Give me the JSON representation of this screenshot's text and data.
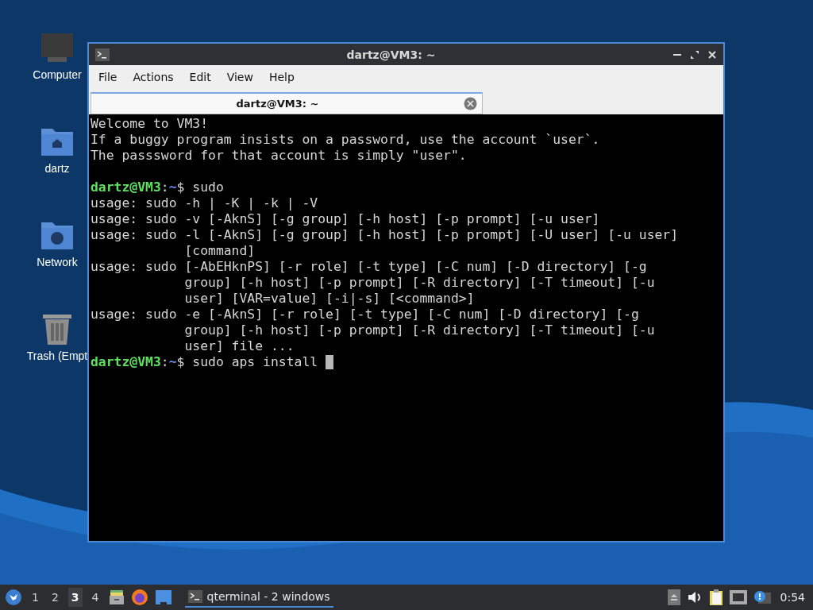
{
  "desktop_icons": [
    {
      "label": "Computer",
      "kind": "computer"
    },
    {
      "label": "dartz",
      "kind": "home"
    },
    {
      "label": "Network",
      "kind": "network"
    },
    {
      "label": "Trash (Empt",
      "kind": "trash"
    }
  ],
  "window": {
    "title": "dartz@VM3: ~",
    "menu": [
      "File",
      "Actions",
      "Edit",
      "View",
      "Help"
    ],
    "tabs": [
      {
        "label": "dartz@VM3: ~",
        "selected": true
      }
    ],
    "lines": [
      {
        "kind": "output",
        "text": "Welcome to VM3!"
      },
      {
        "kind": "output",
        "text": "If a buggy program insists on a password, use the account `user`."
      },
      {
        "kind": "output",
        "text": "The passsword for that account is simply \"user\"."
      },
      {
        "kind": "blank"
      },
      {
        "kind": "prompt",
        "user": "dartz@VM3",
        "sep": ":",
        "path": "~",
        "rest": "$ sudo"
      },
      {
        "kind": "output",
        "text": "usage: sudo -h | -K | -k | -V"
      },
      {
        "kind": "output",
        "text": "usage: sudo -v [-AknS] [-g group] [-h host] [-p prompt] [-u user]"
      },
      {
        "kind": "output",
        "text": "usage: sudo -l [-AknS] [-g group] [-h host] [-p prompt] [-U user] [-u user]"
      },
      {
        "kind": "output",
        "text": "            [command]"
      },
      {
        "kind": "output",
        "text": "usage: sudo [-AbEHknPS] [-r role] [-t type] [-C num] [-D directory] [-g"
      },
      {
        "kind": "output",
        "text": "            group] [-h host] [-p prompt] [-R directory] [-T timeout] [-u"
      },
      {
        "kind": "output",
        "text": "            user] [VAR=value] [-i|-s] [<command>]"
      },
      {
        "kind": "output",
        "text": "usage: sudo -e [-AknS] [-r role] [-t type] [-C num] [-D directory] [-g"
      },
      {
        "kind": "output",
        "text": "            group] [-h host] [-p prompt] [-R directory] [-T timeout] [-u"
      },
      {
        "kind": "output",
        "text": "            user] file ..."
      },
      {
        "kind": "prompt",
        "user": "dartz@VM3",
        "sep": ":",
        "path": "~",
        "rest": "$ sudo aps install ",
        "cursor": true
      }
    ]
  },
  "taskbar": {
    "workspaces": [
      {
        "label": "1",
        "selected": false
      },
      {
        "label": "2",
        "selected": false
      },
      {
        "label": "3",
        "selected": true
      },
      {
        "label": "4",
        "selected": false
      }
    ],
    "task": "qterminal - 2 windows",
    "clock": "0:54"
  }
}
